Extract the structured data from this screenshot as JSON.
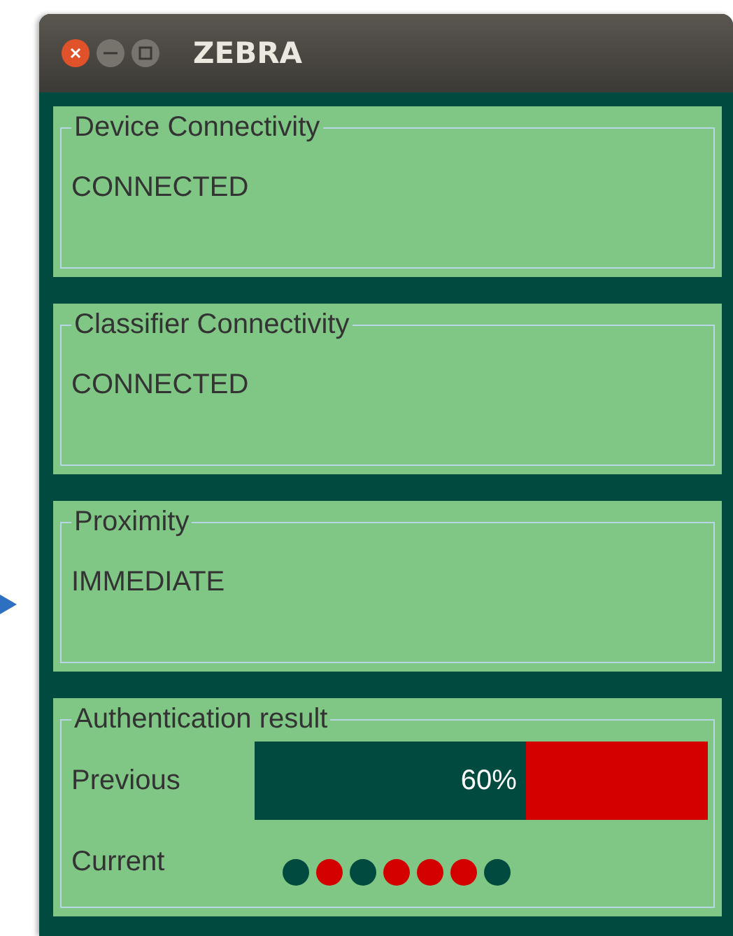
{
  "window": {
    "title": "ZEBRA"
  },
  "panels": [
    {
      "kind": "status",
      "title": "Device Connectivity",
      "value": "CONNECTED"
    },
    {
      "kind": "status",
      "title": "Classifier Connectivity",
      "value": "CONNECTED"
    },
    {
      "kind": "status",
      "title": "Proximity",
      "value": "IMMEDIATE"
    }
  ],
  "authentication": {
    "title": "Authentication result",
    "previous": {
      "label": "Previous",
      "level": 0.6,
      "reading": "60%"
    },
    "current": {
      "label": "Current",
      "dots": [
        {
          "color": "#004a3f"
        },
        {
          "color": "#d40000"
        },
        {
          "color": "#004a3f"
        },
        {
          "color": "#d40000"
        },
        {
          "color": "#d40000"
        },
        {
          "color": "#d40000"
        },
        {
          "color": "#004a3f"
        }
      ]
    }
  }
}
